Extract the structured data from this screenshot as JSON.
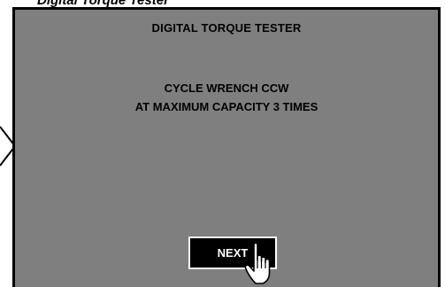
{
  "caption": "Digital Torque Tester",
  "screen": {
    "title": "DIGITAL TORQUE TESTER",
    "instruction_line1": "CYCLE WRENCH CCW",
    "instruction_line2": "AT MAXIMUM CAPACITY 3 TIMES",
    "next_label": "NEXT"
  },
  "colors": {
    "screen_bg": "#7f7f7f",
    "button_bg": "#000000",
    "button_text": "#ffffff"
  },
  "icons": {
    "cursor": "hand-pointer-icon",
    "arrow": "chevron-right-icon"
  }
}
